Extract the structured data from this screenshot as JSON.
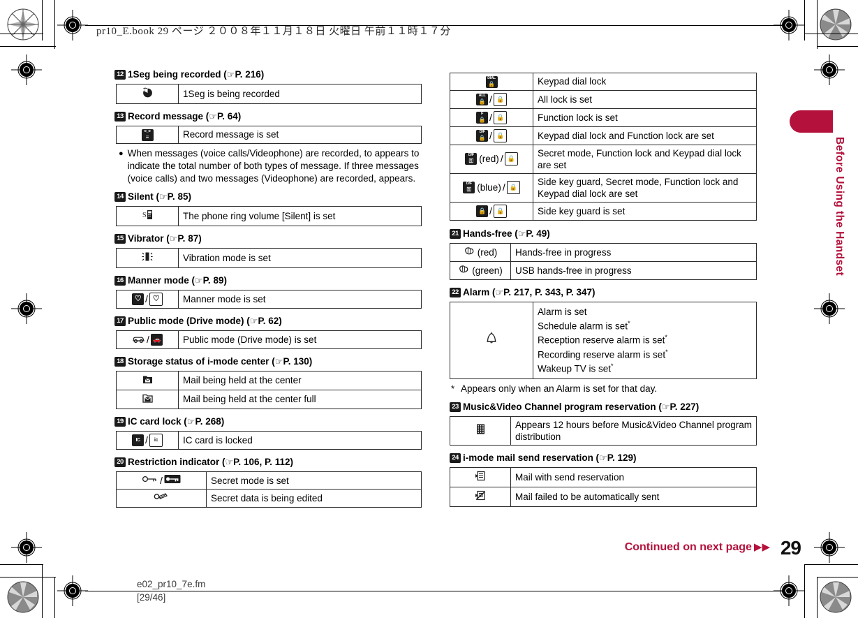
{
  "header": {
    "print_info": "pr10_E.book   29 ページ   ２００８年１１月１８日   火曜日   午前１１時１７分"
  },
  "side_tab": {
    "label": "Before Using the Handset"
  },
  "footer": {
    "continued": "Continued on next page",
    "continued_arrow": "▶▶",
    "page_number": "29",
    "file_name": "e02_pr10_7e.fm",
    "file_page": "[29/46]"
  },
  "left_column": {
    "sections": [
      {
        "num": "12",
        "title": "1Seg being recorded (",
        "pointer": "☞",
        "ref": "P. 216)",
        "icon_col": "normal",
        "rows": [
          {
            "icon": "1seg-recording-icon",
            "text": "1Seg is being recorded"
          }
        ]
      },
      {
        "num": "13",
        "title": "Record message (",
        "pointer": "☞",
        "ref": "P. 64)",
        "icon_col": "normal",
        "rows": [
          {
            "icon": "record-message-icon",
            "text": "Record message is set"
          }
        ],
        "note": "When messages (voice calls/Videophone) are recorded,  to  appears to indicate the total number of both types of message. If three messages (voice calls) and two messages (Videophone) are recorded,  appears."
      },
      {
        "num": "14",
        "title": "Silent (",
        "pointer": "☞",
        "ref": "P. 85)",
        "icon_col": "normal",
        "rows": [
          {
            "icon": "silent-icon",
            "text": "The phone ring volume [Silent] is set"
          }
        ]
      },
      {
        "num": "15",
        "title": "Vibrator (",
        "pointer": "☞",
        "ref": "P. 87)",
        "icon_col": "normal",
        "rows": [
          {
            "icon": "vibrator-icon",
            "text": "Vibration mode is set"
          }
        ]
      },
      {
        "num": "16",
        "title": "Manner mode (",
        "pointer": "☞",
        "ref": "P. 89)",
        "icon_col": "normal",
        "rows": [
          {
            "icon": "manner-mode-icon",
            "text": "Manner mode is set"
          }
        ]
      },
      {
        "num": "17",
        "title": "Public mode (Drive mode) (",
        "pointer": "☞",
        "ref": "P. 62)",
        "icon_col": "normal",
        "rows": [
          {
            "icon": "drive-mode-icon",
            "text": "Public mode (Drive mode) is set"
          }
        ]
      },
      {
        "num": "18",
        "title": "Storage status of i-mode center (",
        "pointer": "☞",
        "ref": "P. 130)",
        "icon_col": "normal",
        "rows": [
          {
            "icon": "mail-held-icon",
            "text": "Mail being held at the center"
          },
          {
            "icon": "mail-held-full-icon",
            "text": "Mail being held at the center full"
          }
        ]
      },
      {
        "num": "19",
        "title": "IC card lock (",
        "pointer": "☞",
        "ref": "P. 268)",
        "icon_col": "normal",
        "rows": [
          {
            "icon": "ic-card-lock-icon",
            "text": "IC card is locked"
          }
        ]
      },
      {
        "num": "20",
        "title": "Restriction indicator (",
        "pointer": "☞",
        "ref": "P. 106, P. 112)",
        "icon_col": "wide",
        "rows": [
          {
            "icon": "secret-mode-icon",
            "text": "Secret mode is set"
          },
          {
            "icon": "secret-data-editing-icon",
            "text": "Secret data is being edited"
          }
        ]
      }
    ]
  },
  "right_column": {
    "lock_table_rows": [
      {
        "icon": "keypad-dial-lock-icon",
        "text": "Keypad dial lock"
      },
      {
        "icon": "all-lock-icon",
        "text": "All lock is set"
      },
      {
        "icon": "function-lock-icon",
        "text": "Function lock is set"
      },
      {
        "icon": "keypad-and-function-lock-icon",
        "text": "Keypad dial lock and Function lock are set"
      },
      {
        "icon": "secret-function-keypad-lock-red-icon",
        "label": "(red)",
        "text": "Secret mode, Function lock and Keypad dial lock are set"
      },
      {
        "icon": "secret-function-keypad-lock-blue-icon",
        "label": "(blue)",
        "text": "Side key guard, Secret mode, Function lock and Keypad dial lock are set"
      },
      {
        "icon": "side-key-guard-icon",
        "text": "Side key guard is set"
      }
    ],
    "sections": [
      {
        "num": "21",
        "title": "Hands-free (",
        "pointer": "☞",
        "ref": "P. 49)",
        "icon_col": "normal",
        "rows": [
          {
            "icon": "hands-free-red-icon",
            "label": "(red)",
            "text": "Hands-free in progress"
          },
          {
            "icon": "hands-free-green-icon",
            "label": "(green)",
            "text": "USB hands-free in progress"
          }
        ]
      },
      {
        "num": "22",
        "title": "Alarm (",
        "pointer": "☞",
        "ref": "P. 217, P. 343, P. 347)",
        "icon_col": "normal",
        "alarm_lines": [
          "Alarm is set",
          "Schedule alarm is set*",
          "Reception reserve alarm is set*",
          "Recording reserve alarm is set*",
          "Wakeup TV is set*"
        ],
        "footnote": "Appears only when an Alarm is set for that day."
      },
      {
        "num": "23",
        "title": "Music&Video Channel program reservation (",
        "pointer": "☞",
        "ref": "P. 227)",
        "icon_col": "normal",
        "rows": [
          {
            "icon": "music-video-channel-icon",
            "text": "Appears 12 hours before Music&Video Channel program distribution"
          }
        ]
      },
      {
        "num": "24",
        "title": "i-mode mail send reservation (",
        "pointer": "☞",
        "ref": "P. 129)",
        "icon_col": "normal",
        "rows": [
          {
            "icon": "mail-send-reservation-icon",
            "text": "Mail with send reservation"
          },
          {
            "icon": "mail-send-failed-icon",
            "text": "Mail failed to be automatically sent"
          }
        ]
      }
    ]
  },
  "colors": {
    "accent": "#b4123c",
    "text": "#000000",
    "rule": "#2b2b2b"
  }
}
